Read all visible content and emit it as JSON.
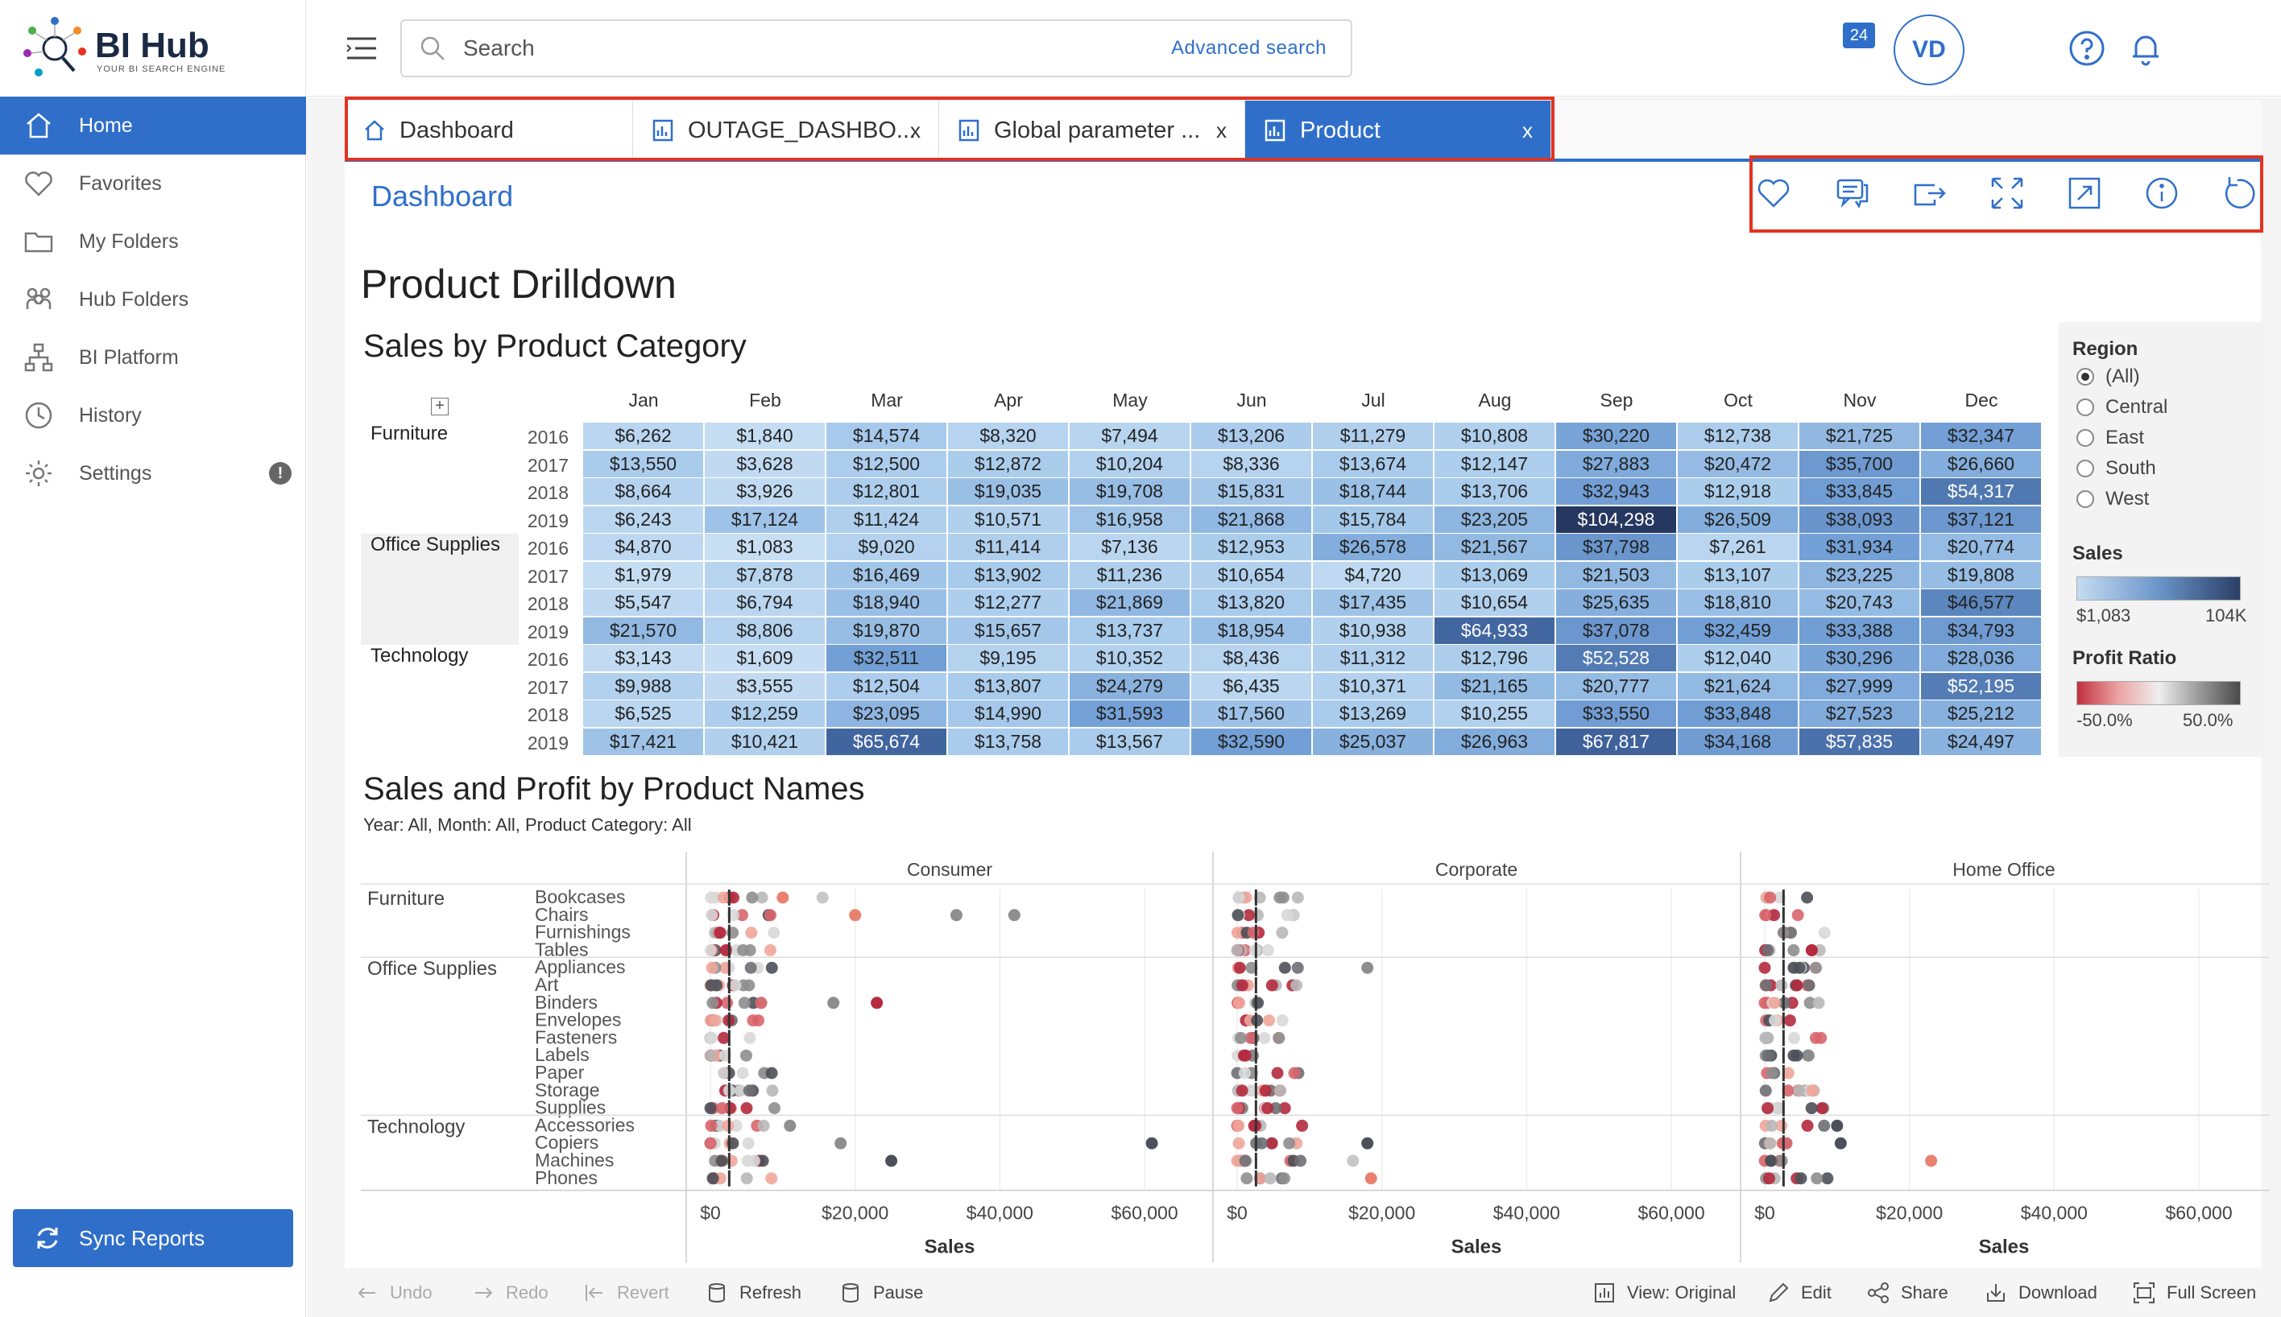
{
  "brand": {
    "name": "BI Hub",
    "tagline": "YOUR BI SEARCH ENGINE"
  },
  "sidebar": {
    "items": [
      {
        "label": "Home",
        "icon": "home-icon",
        "active": true
      },
      {
        "label": "Favorites",
        "icon": "heart-icon"
      },
      {
        "label": "My Folders",
        "icon": "folder-icon"
      },
      {
        "label": "Hub Folders",
        "icon": "people-icon"
      },
      {
        "label": "BI Platform",
        "icon": "hierarchy-icon"
      },
      {
        "label": "History",
        "icon": "clock-icon"
      },
      {
        "label": "Settings",
        "icon": "gear-icon",
        "badge": "!"
      }
    ],
    "sync_label": "Sync Reports"
  },
  "topbar": {
    "search_placeholder": "Search",
    "advanced_search": "Advanced search",
    "notifications_count": "24",
    "avatar_initials": "VD"
  },
  "tabs": [
    {
      "label": "Dashboard",
      "icon": "home-icon",
      "closable": false
    },
    {
      "label": "OUTAGE_DASHBO...",
      "icon": "report-icon",
      "closable": true,
      "close": "x"
    },
    {
      "label": "Global parameter ...",
      "icon": "report-icon",
      "closable": true,
      "close": "x"
    },
    {
      "label": "Product",
      "icon": "report-icon",
      "closable": true,
      "active": true,
      "close": "x"
    }
  ],
  "page": {
    "breadcrumb": "Dashboard"
  },
  "actions": [
    "heart-icon",
    "comment-icon",
    "share-icon",
    "expand-icon",
    "open-external-icon",
    "info-icon",
    "refresh-icon"
  ],
  "dashboard": {
    "title": "Product Drilldown",
    "heatmap_title": "Sales by Product Category",
    "scatter_title": "Sales and Profit by Product Names",
    "scatter_subtitle": "Year: All, Month: All, Product Category: All"
  },
  "filters": {
    "region_title": "Region",
    "regions": [
      {
        "label": "(All)",
        "checked": true
      },
      {
        "label": "Central"
      },
      {
        "label": "East"
      },
      {
        "label": "South"
      },
      {
        "label": "West"
      }
    ],
    "sales_title": "Sales",
    "sales_min": "$1,083",
    "sales_max": "104K",
    "profit_title": "Profit Ratio",
    "profit_min": "-50.0%",
    "profit_max": "50.0%"
  },
  "chart_data": [
    {
      "type": "heatmap",
      "title": "Sales by Product Category",
      "months": [
        "Jan",
        "Feb",
        "Mar",
        "Apr",
        "May",
        "Jun",
        "Jul",
        "Aug",
        "Sep",
        "Oct",
        "Nov",
        "Dec"
      ],
      "rows": [
        {
          "category": "Furniture",
          "year": "2016",
          "values": [
            6262,
            1840,
            14574,
            8320,
            7494,
            13206,
            11279,
            10808,
            30220,
            12738,
            21725,
            32347
          ]
        },
        {
          "category": "",
          "year": "2017",
          "values": [
            13550,
            3628,
            12500,
            12872,
            10204,
            8336,
            13674,
            12147,
            27883,
            20472,
            35700,
            26660
          ]
        },
        {
          "category": "",
          "year": "2018",
          "values": [
            8664,
            3926,
            12801,
            19035,
            19708,
            15831,
            18744,
            13706,
            32943,
            12918,
            33845,
            54317
          ]
        },
        {
          "category": "",
          "year": "2019",
          "values": [
            6243,
            17124,
            11424,
            10571,
            16958,
            21868,
            15784,
            23205,
            104298,
            26509,
            38093,
            37121
          ]
        },
        {
          "category": "Office Supplies",
          "year": "2016",
          "values": [
            4870,
            1083,
            9020,
            11414,
            7136,
            12953,
            26578,
            21567,
            37798,
            7261,
            31934,
            20774
          ]
        },
        {
          "category": "",
          "year": "2017",
          "values": [
            1979,
            7878,
            16469,
            13902,
            11236,
            10654,
            4720,
            13069,
            21503,
            13107,
            23225,
            19808
          ]
        },
        {
          "category": "",
          "year": "2018",
          "values": [
            5547,
            6794,
            18940,
            12277,
            21869,
            13820,
            17435,
            10654,
            25635,
            18810,
            20743,
            46577
          ]
        },
        {
          "category": "",
          "year": "2019",
          "values": [
            21570,
            8806,
            19870,
            15657,
            13737,
            18954,
            10938,
            64933,
            37078,
            32459,
            33388,
            34793
          ]
        },
        {
          "category": "Technology",
          "year": "2016",
          "values": [
            3143,
            1609,
            32511,
            9195,
            10352,
            8436,
            11312,
            12796,
            52528,
            12040,
            30296,
            28036
          ]
        },
        {
          "category": "",
          "year": "2017",
          "values": [
            9988,
            3555,
            12504,
            13807,
            24279,
            6435,
            10371,
            21165,
            20777,
            21624,
            27999,
            52195
          ]
        },
        {
          "category": "",
          "year": "2018",
          "values": [
            6525,
            12259,
            23095,
            14990,
            31593,
            17560,
            13269,
            10255,
            33550,
            33848,
            27523,
            25212
          ]
        },
        {
          "category": "",
          "year": "2019",
          "values": [
            17421,
            10421,
            65674,
            13758,
            13567,
            32590,
            25037,
            26963,
            67817,
            34168,
            57835,
            24497
          ]
        }
      ],
      "color_range": [
        1083,
        104298
      ]
    },
    {
      "type": "scatter",
      "title": "Sales and Profit by Product Names",
      "segments": [
        "Consumer",
        "Corporate",
        "Home Office"
      ],
      "categories": [
        {
          "name": "Furniture",
          "subs": [
            "Bookcases",
            "Chairs",
            "Furnishings",
            "Tables"
          ]
        },
        {
          "name": "Office Supplies",
          "subs": [
            "Appliances",
            "Art",
            "Binders",
            "Envelopes",
            "Fasteners",
            "Labels",
            "Paper",
            "Storage",
            "Supplies"
          ]
        },
        {
          "name": "Technology",
          "subs": [
            "Accessories",
            "Copiers",
            "Machines",
            "Phones"
          ]
        }
      ],
      "xlabel": "Sales",
      "xticks": [
        "$0",
        "$20,000",
        "$40,000",
        "$60,000"
      ],
      "xlim": [
        0,
        64000
      ],
      "outliers": [
        {
          "segment": 0,
          "sub": "Bookcases",
          "x": 10000,
          "profit": 0.35
        },
        {
          "segment": 0,
          "sub": "Bookcases",
          "x": 15500,
          "profit": 0
        },
        {
          "segment": 0,
          "sub": "Chairs",
          "x": 20000,
          "profit": 0.35
        },
        {
          "segment": 0,
          "sub": "Chairs",
          "x": 34000,
          "profit": -0.05
        },
        {
          "segment": 0,
          "sub": "Chairs",
          "x": 42000,
          "profit": -0.1
        },
        {
          "segment": 0,
          "sub": "Binders",
          "x": 23000,
          "profit": -0.9
        },
        {
          "segment": 0,
          "sub": "Binders",
          "x": 17000,
          "profit": -0.1
        },
        {
          "segment": 0,
          "sub": "Copiers",
          "x": 18000,
          "profit": -0.1
        },
        {
          "segment": 0,
          "sub": "Accessories",
          "x": 11000,
          "profit": -0.15
        },
        {
          "segment": 0,
          "sub": "Machines",
          "x": 25000,
          "profit": -0.2
        },
        {
          "segment": 0,
          "sub": "Copiers",
          "x": 61000,
          "profit": -0.2
        },
        {
          "segment": 1,
          "sub": "Appliances",
          "x": 18000,
          "profit": -0.05
        },
        {
          "segment": 1,
          "sub": "Copiers",
          "x": 18000,
          "profit": -0.2
        },
        {
          "segment": 1,
          "sub": "Machines",
          "x": 16000,
          "profit": 0
        },
        {
          "segment": 1,
          "sub": "Phones",
          "x": 18500,
          "profit": 0.4
        },
        {
          "segment": 2,
          "sub": "Accessories",
          "x": 10000,
          "profit": -0.2
        },
        {
          "segment": 2,
          "sub": "Copiers",
          "x": 10500,
          "profit": -0.2
        },
        {
          "segment": 2,
          "sub": "Machines",
          "x": 23000,
          "profit": 0.35
        },
        {
          "segment": 2,
          "sub": "Tables",
          "x": 6500,
          "profit": -0.9
        }
      ]
    }
  ],
  "toolbar": {
    "undo": "Undo",
    "redo": "Redo",
    "revert": "Revert",
    "refresh": "Refresh",
    "pause": "Pause",
    "view": "View: Original",
    "edit": "Edit",
    "share": "Share",
    "download": "Download",
    "fullscreen": "Full Screen"
  }
}
